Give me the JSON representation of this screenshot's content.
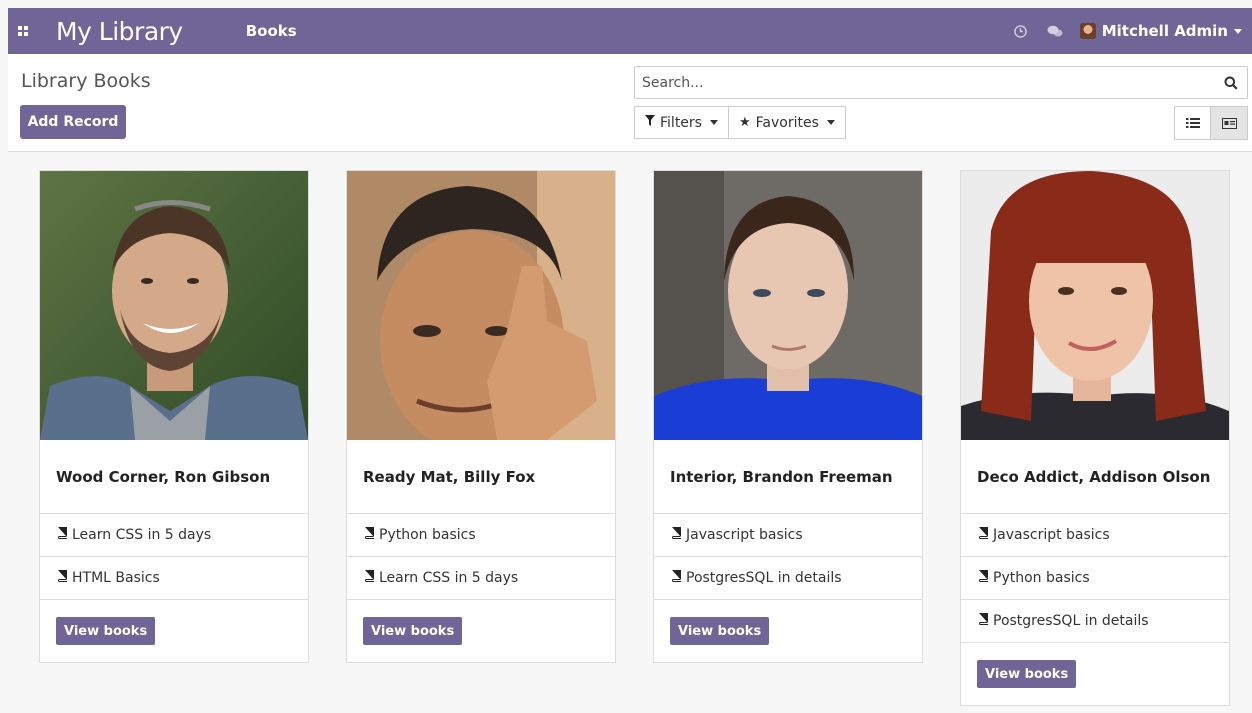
{
  "navbar": {
    "brand": "My Library",
    "menu": "Books",
    "user_name": "Mitchell Admin",
    "color": "#6f6596"
  },
  "control_panel": {
    "title": "Library Books",
    "add_button": "Add Record",
    "search_placeholder": "Search...",
    "filters_label": "Filters",
    "favorites_label": "Favorites"
  },
  "cards": [
    {
      "name": "Wood Corner, Ron Gibson",
      "books": [
        "Learn CSS in 5 days",
        "HTML Basics"
      ],
      "button": "View books"
    },
    {
      "name": "Ready Mat, Billy Fox",
      "books": [
        "Python basics",
        "Learn CSS in 5 days"
      ],
      "button": "View books"
    },
    {
      "name": "Interior, Brandon Freeman",
      "books": [
        "Javascript basics",
        "PostgresSQL in details"
      ],
      "button": "View books"
    },
    {
      "name": "Deco Addict, Addison Olson",
      "books": [
        "Javascript basics",
        "Python basics",
        "PostgresSQL in details"
      ],
      "button": "View books"
    }
  ]
}
